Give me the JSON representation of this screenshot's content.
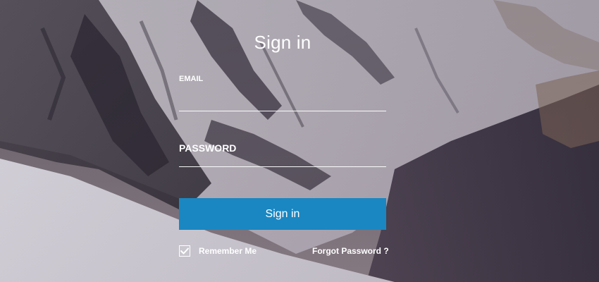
{
  "form": {
    "title": "Sign in",
    "email_label": "EMAIL",
    "email_value": "",
    "password_label": "PASSWORD",
    "password_value": "",
    "submit_label": "Sign in",
    "remember_label": "Remember Me",
    "remember_checked": true,
    "forgot_label": "Forgot Password ?"
  },
  "icons": {
    "checkbox": "checkmark-icon"
  },
  "colors": {
    "button": "#1a87c2",
    "text": "#ffffff",
    "underline": "#ffffff"
  }
}
